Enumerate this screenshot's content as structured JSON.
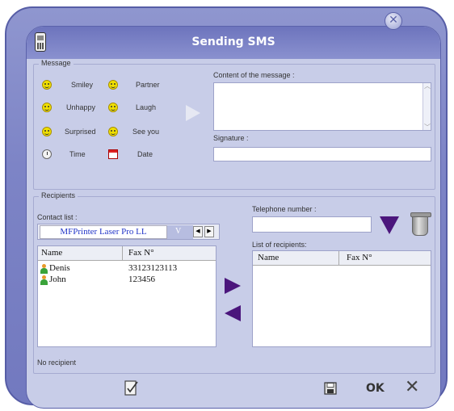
{
  "window": {
    "title": "Sending SMS",
    "close_glyph": "✕"
  },
  "message_group": {
    "legend": "Message",
    "emoticons": [
      {
        "label": "Smiley",
        "icon": "smiley-icon"
      },
      {
        "label": "Partner",
        "icon": "smiley-icon"
      },
      {
        "label": "Unhappy",
        "icon": "smiley-icon"
      },
      {
        "label": "Laugh",
        "icon": "smiley-icon"
      },
      {
        "label": "Surprised",
        "icon": "smiley-icon"
      },
      {
        "label": "See you",
        "icon": "smiley-icon"
      },
      {
        "label": "Time",
        "icon": "clock-icon"
      },
      {
        "label": "Date",
        "icon": "calendar-icon"
      }
    ],
    "content_label": "Content of the message :",
    "content_value": "",
    "signature_label": "Signature :",
    "signature_value": ""
  },
  "recipients_group": {
    "legend": "Recipients",
    "contact_list_label": "Contact list :",
    "active_tab": "MFPrinter Laser Pro LL",
    "second_tab": "V",
    "nav_prev": "◀",
    "nav_next": "▶",
    "contacts_table": {
      "columns": [
        "Name",
        "Fax N°"
      ],
      "rows": [
        {
          "name": "Denis",
          "fax": "33123123113"
        },
        {
          "name": "John",
          "fax": "123456"
        }
      ]
    },
    "telephone_label": "Telephone number :",
    "telephone_value": "",
    "recipients_list_label": "List of recipients:",
    "recipients_table": {
      "columns": [
        "Name",
        "Fax N°"
      ],
      "rows": []
    },
    "status_text": "No recipient"
  },
  "footer": {
    "ok_label": "OK",
    "cancel_glyph": "✕"
  },
  "colors": {
    "frame": "#7d84c6",
    "panel": "#c8cde8",
    "arrow": "#4b167c",
    "tab_text": "#2235c8"
  }
}
